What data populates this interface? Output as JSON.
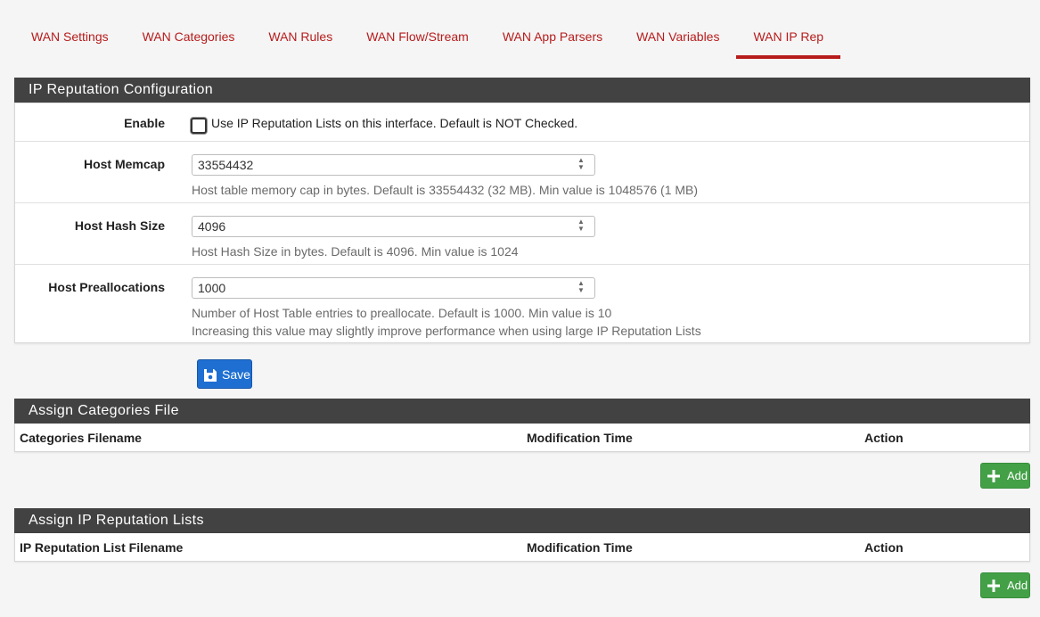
{
  "tabs": [
    {
      "label": "WAN Settings"
    },
    {
      "label": "WAN Categories"
    },
    {
      "label": "WAN Rules"
    },
    {
      "label": "WAN Flow/Stream"
    },
    {
      "label": "WAN App Parsers"
    },
    {
      "label": "WAN Variables"
    },
    {
      "label": "WAN IP Rep",
      "active": true
    }
  ],
  "config": {
    "title": "IP Reputation Configuration",
    "enable": {
      "label": "Enable",
      "text": "Use IP Reputation Lists on this interface. Default is NOT Checked.",
      "checked": false
    },
    "memcap": {
      "label": "Host Memcap",
      "value": "33554432",
      "help": "Host table memory cap in bytes. Default is 33554432 (32 MB). Min value is 1048576 (1 MB)"
    },
    "hash": {
      "label": "Host Hash Size",
      "value": "4096",
      "help": "Host Hash Size in bytes. Default is 4096. Min value is 1024"
    },
    "prealloc": {
      "label": "Host Preallocations",
      "value": "1000",
      "help1": "Number of Host Table entries to preallocate. Default is 1000. Min value is 10",
      "help2": "Increasing this value may slightly improve performance when using large IP Reputation Lists"
    },
    "save_label": "Save"
  },
  "categories": {
    "title": "Assign Categories File",
    "col_filename": "Categories Filename",
    "col_modtime": "Modification Time",
    "col_action": "Action",
    "add_label": "Add"
  },
  "iprep": {
    "title": "Assign IP Reputation Lists",
    "col_filename": "IP Reputation List Filename",
    "col_modtime": "Modification Time",
    "col_action": "Action",
    "add_label": "Add"
  },
  "colors": {
    "accent": "#b71c1c",
    "panel_heading": "#424242",
    "save": "#1e6fd1",
    "add": "#43a047"
  },
  "icons": {
    "save": "save-icon",
    "add": "plus-icon",
    "spinner": "spinner-arrows-icon"
  }
}
